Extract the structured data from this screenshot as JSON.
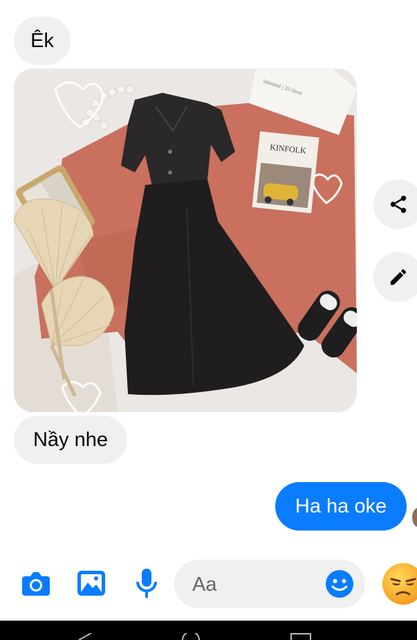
{
  "thread": {
    "messages": [
      {
        "direction": "incoming",
        "text": "Êk"
      },
      {
        "direction": "incoming",
        "type": "photo",
        "magazine_title": "KINFOLK"
      },
      {
        "direction": "incoming",
        "text": "Nầy nhe"
      },
      {
        "direction": "outgoing",
        "text": "Ha ha oke"
      }
    ]
  },
  "photo_actions": {
    "share_icon": "share-icon",
    "edit_icon": "pencil-icon"
  },
  "composer": {
    "placeholder": "Aa",
    "tools": [
      "camera-icon",
      "image-icon",
      "microphone-icon"
    ],
    "emoji_icon": "smiley-icon",
    "quick_reaction": "unamused-face-emoji"
  },
  "colors": {
    "accent": "#0a7cff",
    "incoming_bubble": "#f0f0f0",
    "outgoing_bubble": "#0a7cff"
  }
}
